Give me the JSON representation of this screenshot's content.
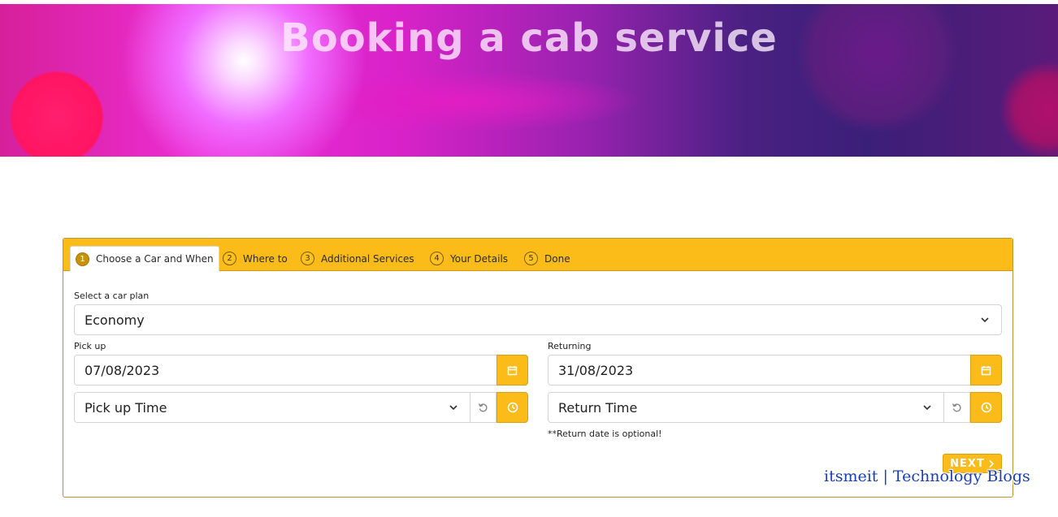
{
  "hero": {
    "title": "Booking a cab service"
  },
  "tabs": [
    {
      "num": "1",
      "label": "Choose a Car and When",
      "active": true
    },
    {
      "num": "2",
      "label": "Where to",
      "active": false
    },
    {
      "num": "3",
      "label": "Additional Services",
      "active": false
    },
    {
      "num": "4",
      "label": "Your Details",
      "active": false
    },
    {
      "num": "5",
      "label": "Done",
      "active": false
    }
  ],
  "form": {
    "car_plan_label": "Select a car plan",
    "car_plan_value": "Economy",
    "pickup_label": "Pick up",
    "pickup_date": "07/08/2023",
    "pickup_time_placeholder": "Pick up Time",
    "returning_label": "Returning",
    "return_date": "31/08/2023",
    "return_time_placeholder": "Return Time",
    "return_note": "**Return date is optional!"
  },
  "actions": {
    "next_label": "NEXT"
  },
  "watermark": "itsmeit | Technology Blogs",
  "colors": {
    "accent": "#fbbc1a",
    "border": "#b59a2a"
  },
  "icons": [
    "calendar-icon",
    "clock-icon",
    "reset-icon",
    "chevron-down-icon",
    "chevron-right-icon"
  ]
}
